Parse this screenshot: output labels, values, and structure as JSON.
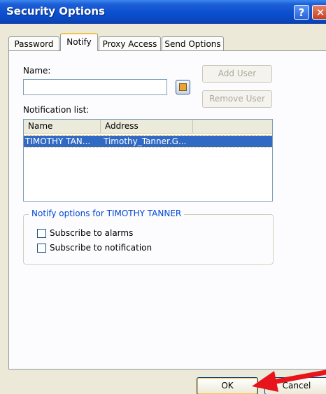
{
  "window": {
    "title": "Security Options"
  },
  "titlebar": {
    "help_glyph": "?",
    "close_glyph": "✕"
  },
  "tabs": [
    {
      "label": "Password"
    },
    {
      "label": "Notify"
    },
    {
      "label": "Proxy Access"
    },
    {
      "label": "Send Options"
    }
  ],
  "notify": {
    "name_label": "Name:",
    "name_value": "",
    "add_user_label": "Add User",
    "remove_user_label": "Remove User",
    "notification_list_label": "Notification list:",
    "columns": [
      "Name",
      "Address"
    ],
    "rows": [
      {
        "name": "TIMOTHY TAN...",
        "address": "Timothy_Tanner.G..."
      }
    ],
    "options_legend": "Notify options for TIMOTHY TANNER",
    "subscribe_alarms_label": "Subscribe to alarms",
    "subscribe_notification_label": "Subscribe to notification"
  },
  "footer": {
    "ok_label": "OK",
    "cancel_label": "Cancel"
  },
  "colors": {
    "annotation_arrow": "#e8141c",
    "selection": "#316ac5",
    "titlebar": "#0b4fd0"
  }
}
